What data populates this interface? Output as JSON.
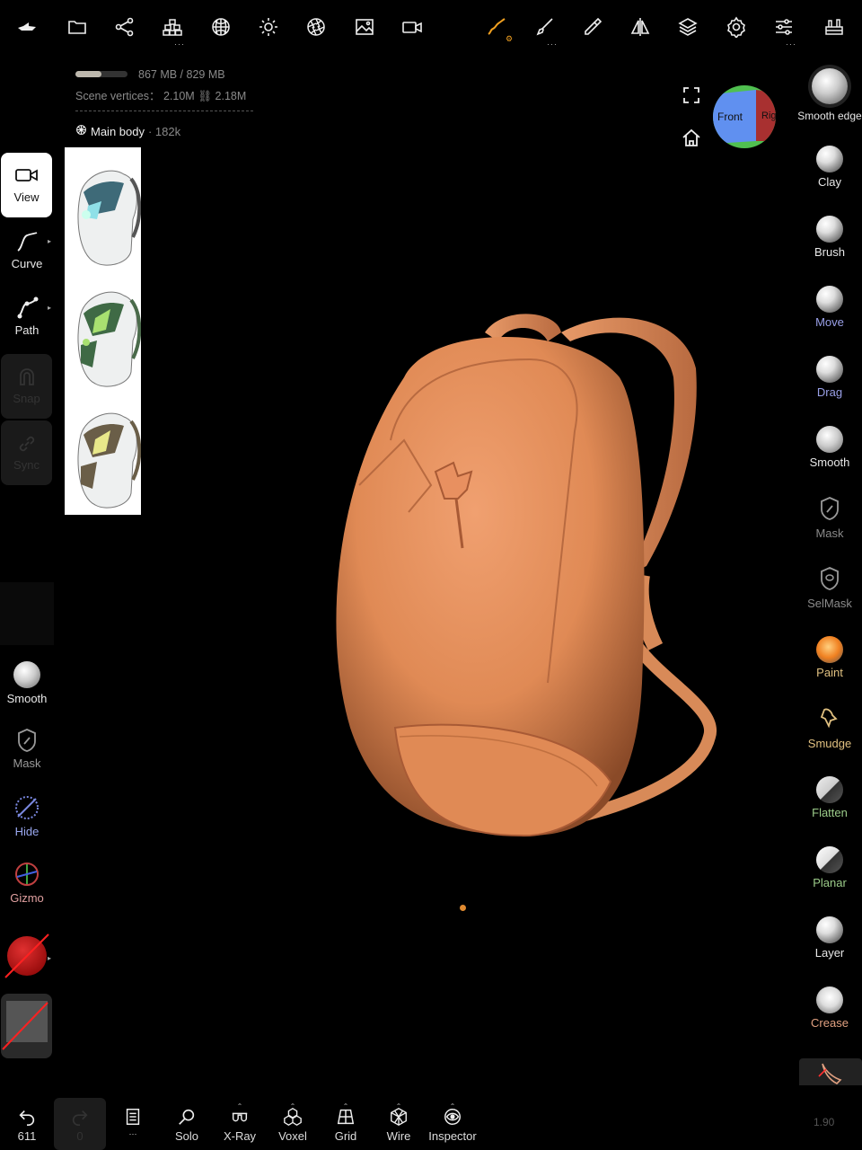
{
  "toolbar": {
    "icons": [
      "boat-icon",
      "folder-icon",
      "scene-graph-icon",
      "topology-icon",
      "material-sphere-icon",
      "light-icon",
      "camera-aperture-icon",
      "image-icon",
      "video-icon",
      "stroke-icon",
      "brush-icon",
      "picker-icon",
      "symmetry-icon",
      "layers-icon",
      "settings-icon",
      "sliders-icon",
      "tools-icon"
    ],
    "accent": "#f0a020"
  },
  "memory": {
    "text": "867 MB / 829 MB",
    "fill_fraction": 0.5
  },
  "scene": {
    "vertices_text": "Scene vertices： 2.10M · 🔗 2.18M",
    "vertices_label": "Scene vertices： 2.10M",
    "linked": "2.18M"
  },
  "mesh": {
    "name": "Main body",
    "count": "· 182k"
  },
  "left_tools": {
    "view": "View",
    "curve": "Curve",
    "path": "Path",
    "snap": "Snap",
    "sync": "Sync",
    "smooth": "Smooth",
    "mask": "Mask",
    "hide": "Hide",
    "gizmo": "Gizmo"
  },
  "right_tools": [
    {
      "label": "Smooth edge",
      "color": "#e8e8e8"
    },
    {
      "label": "Clay",
      "color": "#e8e8e8"
    },
    {
      "label": "Brush",
      "color": "#e8e8e8"
    },
    {
      "label": "Move",
      "color": "#9aa0e8"
    },
    {
      "label": "Drag",
      "color": "#9aa0e8"
    },
    {
      "label": "Smooth",
      "color": "#e8e8e8"
    },
    {
      "label": "Mask",
      "color": "#8a8a8a"
    },
    {
      "label": "SelMask",
      "color": "#8a8a8a"
    },
    {
      "label": "Paint",
      "color": "#e0c080"
    },
    {
      "label": "Smudge",
      "color": "#e0c080"
    },
    {
      "label": "Flatten",
      "color": "#9ccc8a"
    },
    {
      "label": "Planar",
      "color": "#9ccc8a"
    },
    {
      "label": "Layer",
      "color": "#e8e8e8"
    },
    {
      "label": "Crease",
      "color": "#e0a080"
    }
  ],
  "view_cube": {
    "front": "Front",
    "right": "Rig"
  },
  "bottom": {
    "undo_count": "611",
    "redo_count": "0",
    "solo": "Solo",
    "xray": "X-Ray",
    "voxel": "Voxel",
    "grid": "Grid",
    "wire": "Wire",
    "inspector": "Inspector",
    "fps": "1.90"
  }
}
